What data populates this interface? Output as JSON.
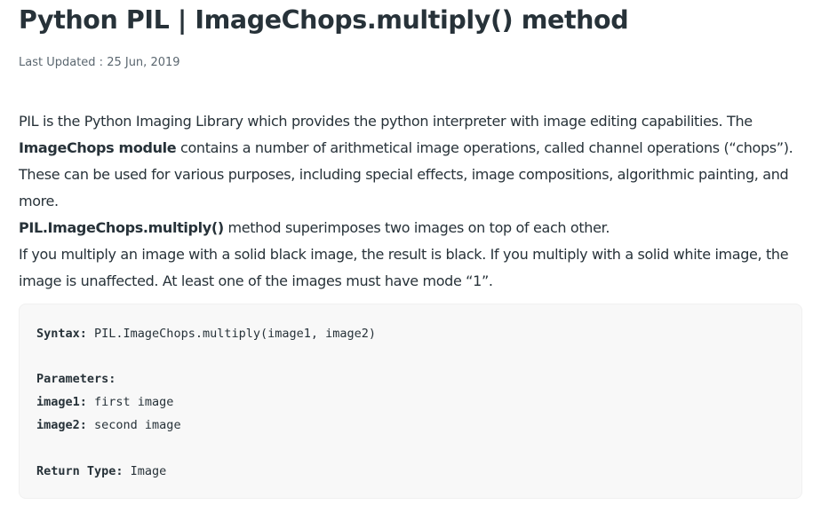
{
  "article": {
    "title": "Python PIL | ImageChops.multiply() method",
    "last_updated": "Last Updated : 25 Jun, 2019",
    "para1_a": "PIL is the Python Imaging Library which provides the python interpreter with image editing capabilities. The ",
    "para1_bold": "ImageChops module",
    "para1_b": " contains a number of arithmetical image operations, called channel operations (“chops”). These can be used for various purposes, including special effects, image compositions, algorithmic painting, and more.",
    "para2_bold": "PIL.ImageChops.multiply()",
    "para2": " method superimposes two images on top of each other.",
    "para3": "If you multiply an image with a solid black image, the result is black. If you multiply with a solid white image, the image is unaffected. At least one of the images must have mode “1”."
  },
  "code": {
    "syntax_label": "Syntax:",
    "syntax_value": " PIL.ImageChops.multiply(image1, image2)",
    "parameters_label": "Parameters:",
    "param1_label": "image1:",
    "param1_value": " first image",
    "param2_label": "image2:",
    "param2_value": " second image",
    "return_label": "Return Type:",
    "return_value": " Image"
  }
}
